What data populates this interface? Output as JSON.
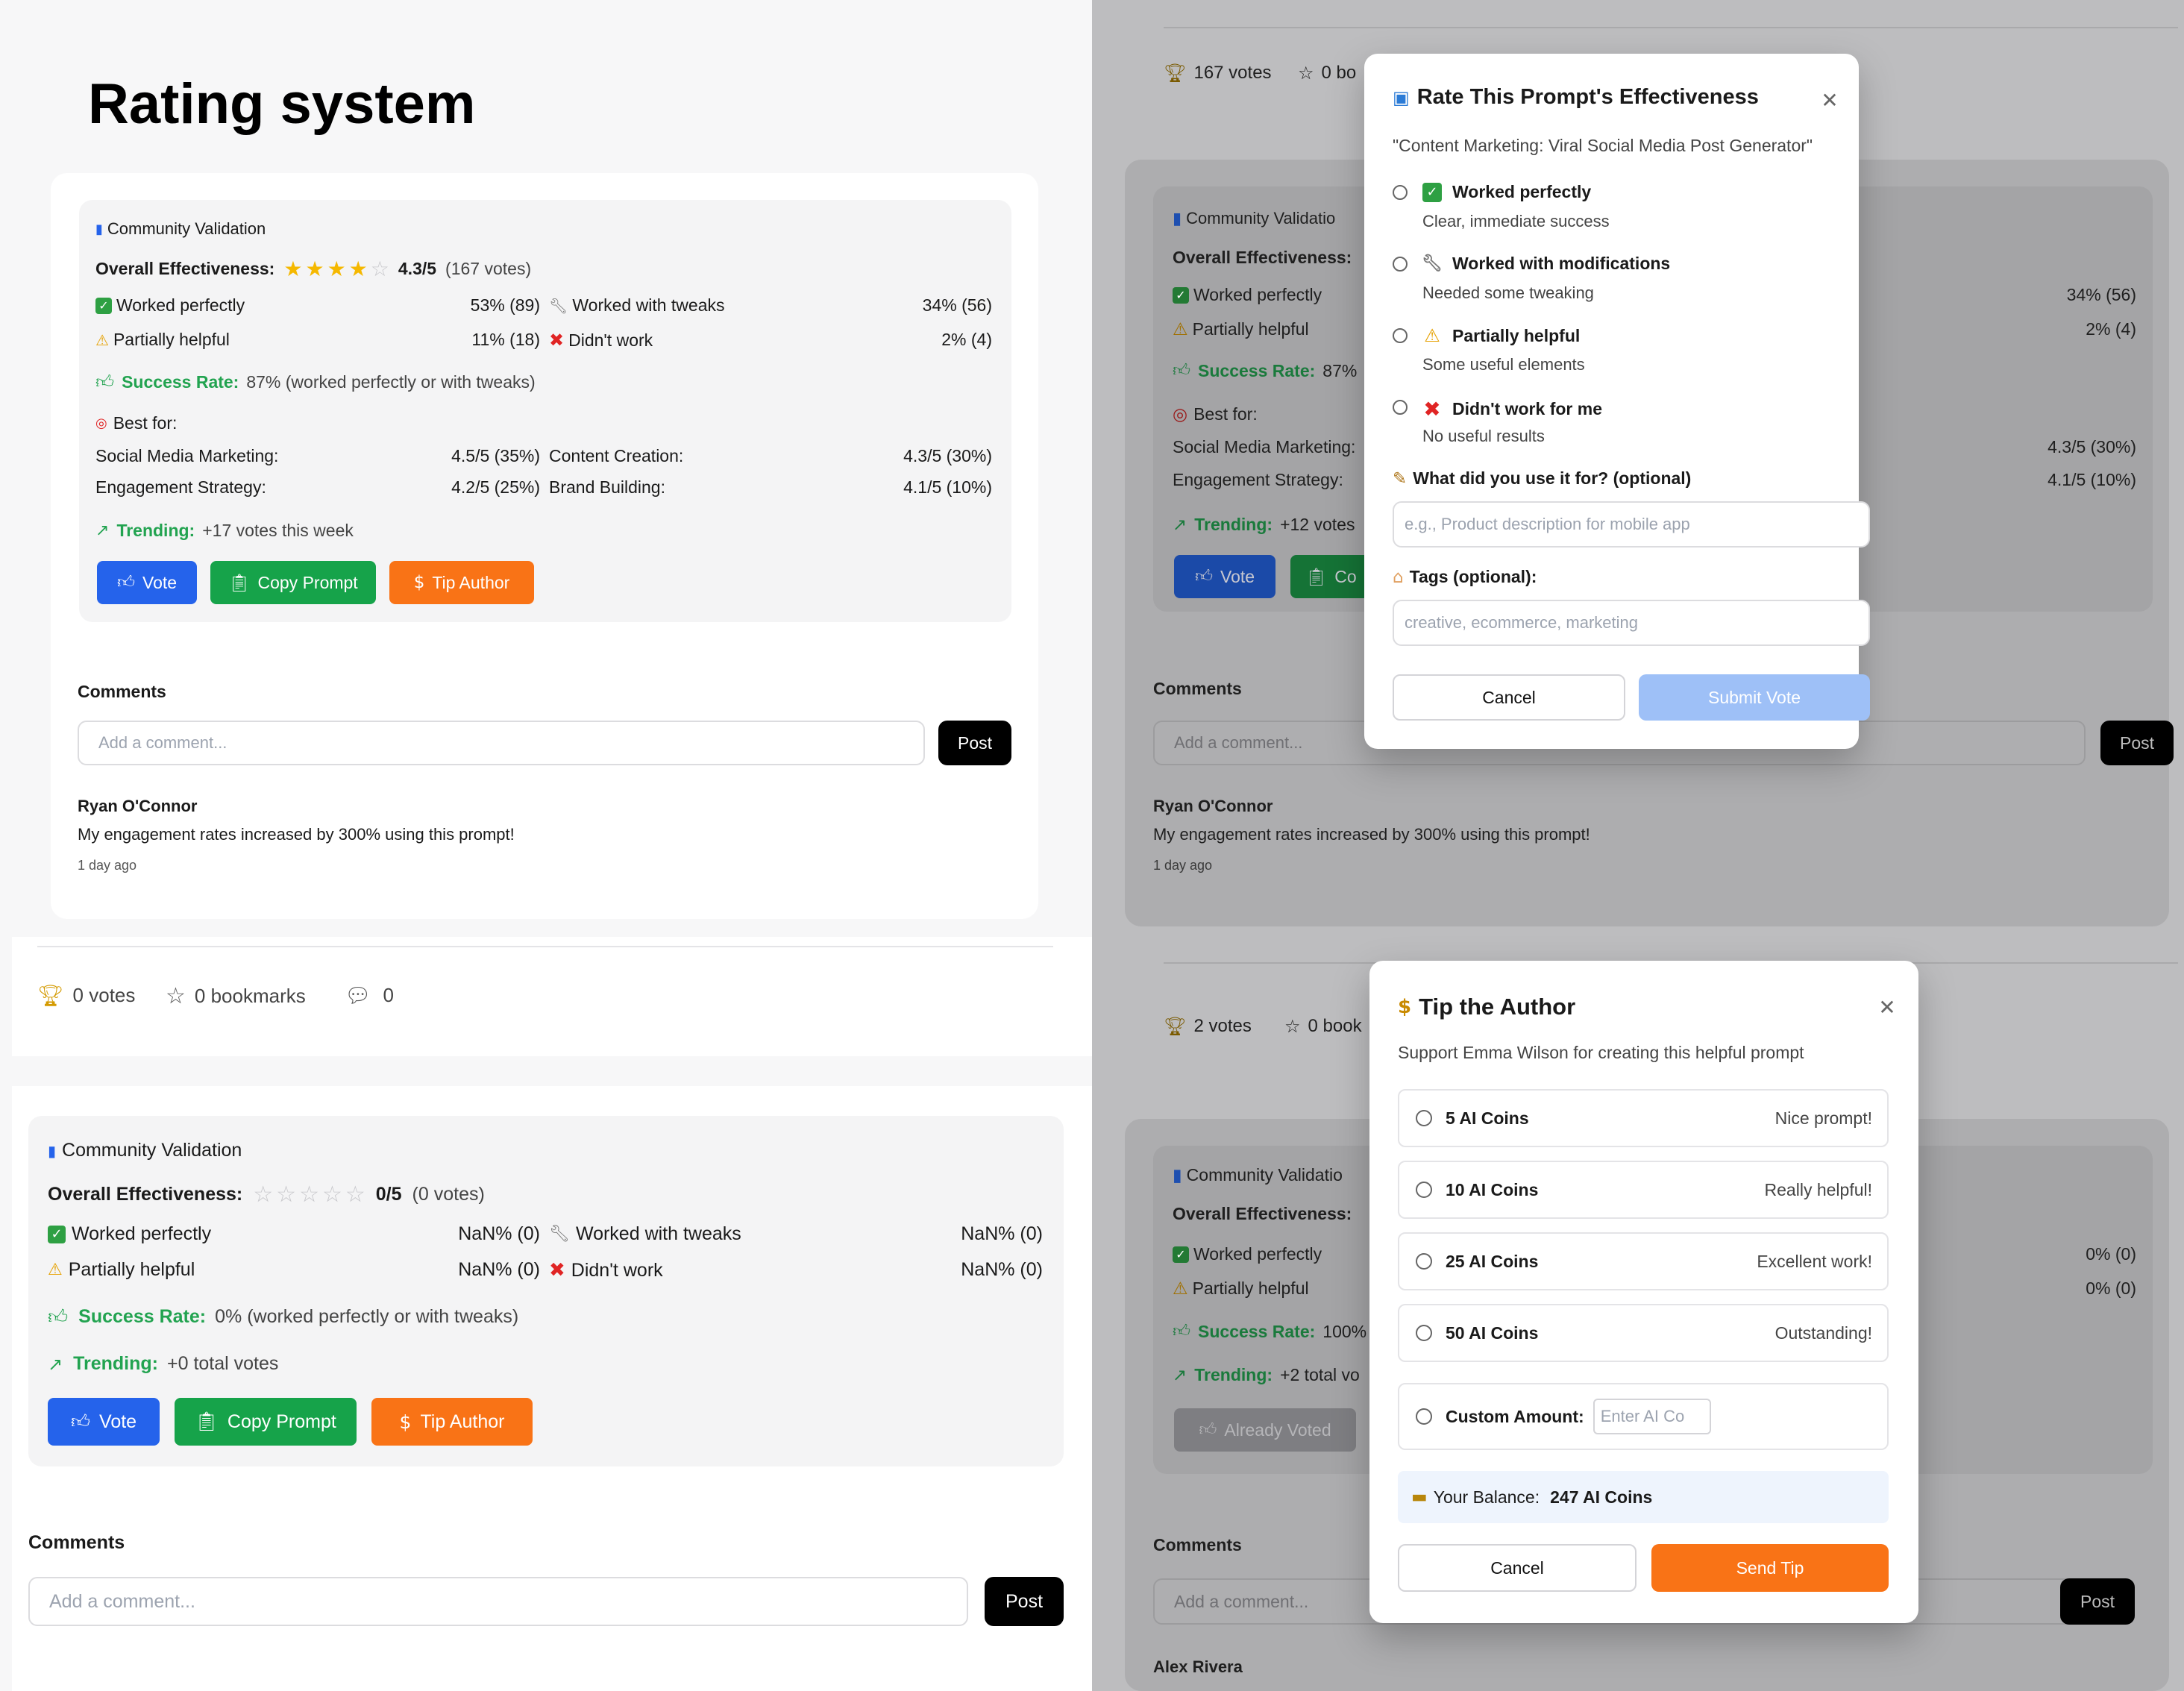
{
  "page_title": "Rating system",
  "card1": {
    "heading": "Community Validation",
    "overall_label": "Overall Effectiveness:",
    "rating": "4.3/5",
    "votes": "(167 votes)",
    "worked_perfectly": {
      "label": "Worked perfectly",
      "value": "53% (89)"
    },
    "worked_tweaks": {
      "label": "Worked with tweaks",
      "value": "34% (56)"
    },
    "partially": {
      "label": "Partially helpful",
      "value": "11% (18)"
    },
    "didnt": {
      "label": "Didn't work",
      "value": "2% (4)"
    },
    "success_label": "Success Rate:",
    "success_text": "87% (worked perfectly or with tweaks)",
    "best_for": "Best for:",
    "best": [
      {
        "label": "Social Media Marketing:",
        "value": "4.5/5 (35%)"
      },
      {
        "label": "Content Creation:",
        "value": "4.3/5 (30%)"
      },
      {
        "label": "Engagement Strategy:",
        "value": "4.2/5 (25%)"
      },
      {
        "label": "Brand Building:",
        "value": "4.1/5 (10%)"
      }
    ],
    "trending_label": "Trending:",
    "trending_text": "+17 votes this week",
    "vote": "Vote",
    "copy": "Copy Prompt",
    "tip": "Tip Author",
    "comments": "Comments",
    "comment_placeholder": "Add a comment...",
    "post": "Post",
    "comment_author": "Ryan O'Connor",
    "comment_text": "My engagement rates increased by 300% using this prompt!",
    "comment_time": "1 day ago"
  },
  "stats_bar": {
    "votes": "0 votes",
    "bookmarks": "0 bookmarks",
    "comments": "0"
  },
  "card2": {
    "heading": "Community Validation",
    "overall_label": "Overall Effectiveness:",
    "rating": "0/5",
    "votes": "(0 votes)",
    "worked_perfectly": {
      "label": "Worked perfectly",
      "value": "NaN% (0)"
    },
    "worked_tweaks": {
      "label": "Worked with tweaks",
      "value": "NaN% (0)"
    },
    "partially": {
      "label": "Partially helpful",
      "value": "NaN% (0)"
    },
    "didnt": {
      "label": "Didn't work",
      "value": "NaN% (0)"
    },
    "success_label": "Success Rate:",
    "success_text": "0% (worked perfectly or with tweaks)",
    "trending_label": "Trending:",
    "trending_text": "+0 total votes",
    "vote": "Vote",
    "copy": "Copy Prompt",
    "tip": "Tip Author",
    "comments": "Comments",
    "comment_placeholder": "Add a comment...",
    "post": "Post"
  },
  "bg_top": {
    "votes": "167 votes",
    "bookmarks": "0 bo",
    "heading": "Community Validatio",
    "overall_label": "Overall Effectiveness:",
    "worked_perfectly": "Worked perfectly",
    "wt_value": "34% (56)",
    "partially": "Partially helpful",
    "dw_value": "2% (4)",
    "success_label": "Success Rate:",
    "success_text": "87%",
    "best_for": "Best for:",
    "best1": "Social Media Marketing:",
    "best1_val": "4.3/5 (30%)",
    "best2": "Engagement Strategy:",
    "best2_val": "4.1/5 (10%)",
    "trending_label": "Trending:",
    "trending_text": "+12 votes",
    "vote": "Vote",
    "copy": "Co",
    "comments": "Comments",
    "comment_placeholder": "Add a comment...",
    "post": "Post",
    "comment_author": "Ryan O'Connor",
    "comment_text": "My engagement rates increased by 300% using this prompt!",
    "comment_time": "1 day ago"
  },
  "bg_bottom": {
    "votes": "2 votes",
    "bookmarks": "0 book",
    "heading": "Community Validatio",
    "overall_label": "Overall Effectiveness:",
    "worked_perfectly": "Worked perfectly",
    "wt_value": "0% (0)",
    "partially": "Partially helpful",
    "dw_value": "0% (0)",
    "success_label": "Success Rate:",
    "success_text": "100%",
    "trending_label": "Trending:",
    "trending_text": "+2 total vo",
    "already_voted": "Already Voted",
    "comments": "Comments",
    "comment_placeholder": "Add a comment...",
    "post": "Post",
    "comment_author": "Alex Rivera"
  },
  "rate_modal": {
    "title": "Rate This Prompt's Effectiveness",
    "subtitle": "\"Content Marketing: Viral Social Media Post Generator\"",
    "options": [
      {
        "label": "Worked perfectly",
        "desc": "Clear, immediate success"
      },
      {
        "label": "Worked with modifications",
        "desc": "Needed some tweaking"
      },
      {
        "label": "Partially helpful",
        "desc": "Some useful elements"
      },
      {
        "label": "Didn't work for me",
        "desc": "No useful results"
      }
    ],
    "use_label": "What did you use it for? (optional)",
    "use_placeholder": "e.g., Product description for mobile app",
    "tags_label": "Tags (optional):",
    "tags_placeholder": "creative, ecommerce, marketing",
    "cancel": "Cancel",
    "submit": "Submit Vote"
  },
  "tip_modal": {
    "title": "Tip the Author",
    "subtitle": "Support Emma Wilson for creating this helpful prompt",
    "options": [
      {
        "amount": "5 AI Coins",
        "note": "Nice prompt!"
      },
      {
        "amount": "10 AI Coins",
        "note": "Really helpful!"
      },
      {
        "amount": "25 AI Coins",
        "note": "Excellent work!"
      },
      {
        "amount": "50 AI Coins",
        "note": "Outstanding!"
      }
    ],
    "custom_label": "Custom Amount:",
    "custom_placeholder": "Enter AI Co",
    "balance_label": "Your Balance:",
    "balance_value": "247 AI Coins",
    "cancel": "Cancel",
    "send": "Send Tip"
  },
  "colors": {
    "vote": "#2563eb",
    "copy": "#16a34a",
    "tip": "#f97316",
    "success": "#22a350",
    "star": "#f5b800"
  }
}
